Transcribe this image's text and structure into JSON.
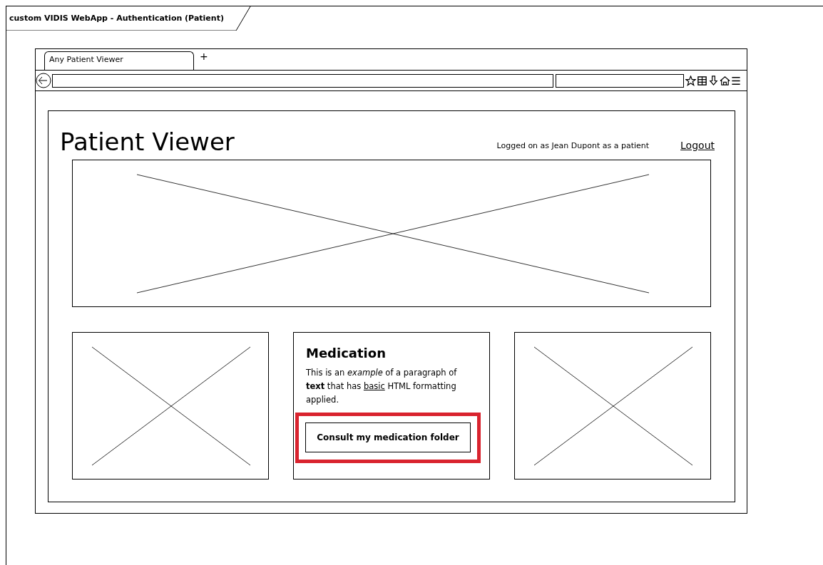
{
  "diagram": {
    "title": "custom VIDIS WebApp - Authentication (Patient)"
  },
  "browser": {
    "tabs": [
      {
        "label": "Any Patient Viewer",
        "selected": true
      }
    ],
    "new_tab": "+"
  },
  "page": {
    "title": "Patient Viewer",
    "user_status": "Logged on as Jean Dupont as a patient",
    "logout": "Logout"
  },
  "panels": [
    {
      "kind": "image"
    },
    {
      "kind": "text",
      "heading": "Medication",
      "paragraph": [
        {
          "text": "This is an *example* of a paragraph of **text** that has ",
          "underlined": false
        },
        {
          "text": "basic",
          "underlined": true
        },
        {
          "text": " HTML formatting applied.",
          "underlined": false
        }
      ],
      "button": "Consult my medication folder",
      "highlighted": true
    },
    {
      "kind": "image"
    }
  ]
}
